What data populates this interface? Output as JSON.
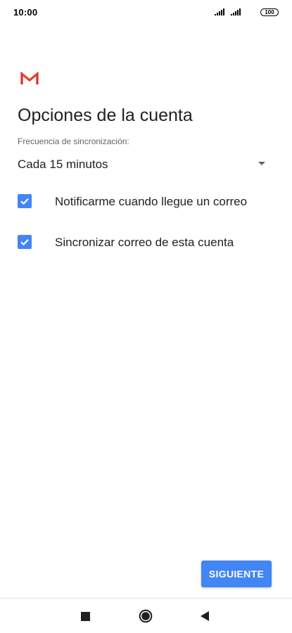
{
  "status_bar": {
    "time": "10:00",
    "battery": "100",
    "icons": [
      "signal-icon",
      "signal-icon",
      "battery-icon"
    ]
  },
  "header": {
    "logo_icon": "gmail-logo-icon",
    "title": "Opciones de la cuenta"
  },
  "sync_frequency": {
    "label": "Frecuencia de sincronización:",
    "selected": "Cada 15 minutos"
  },
  "options": [
    {
      "label": "Notificarme cuando llegue un correo",
      "checked": true
    },
    {
      "label": "Sincronizar correo de esta cuenta",
      "checked": true
    }
  ],
  "footer": {
    "next_label": "SIGUIENTE"
  },
  "nav_bar": {
    "icons": [
      "recents-icon",
      "home-icon",
      "back-icon"
    ]
  },
  "colors": {
    "accent": "#4285f4",
    "gmail_red": "#d93025",
    "text_primary": "#202124",
    "text_secondary": "#5f6368"
  }
}
